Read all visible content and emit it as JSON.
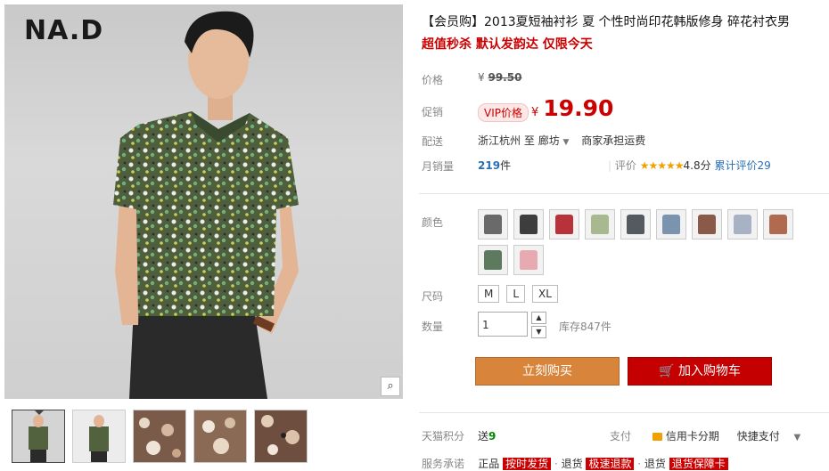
{
  "brand_logo": "NA.D",
  "product": {
    "title": "【会员购】2013夏短袖衬衫 夏 个性时尚印花韩版修身 碎花衬衣男",
    "subtitle": "超值秒杀 默认发韵达 仅限今天"
  },
  "price": {
    "label": "价格",
    "currency": "¥",
    "original": "99.50"
  },
  "promo": {
    "label": "促销",
    "badge": "VIP价格",
    "currency": "¥",
    "price": "19.90"
  },
  "shipping": {
    "label": "配送",
    "from": "浙江杭州",
    "to_word": "至",
    "destination": "廊坊",
    "note": "商家承担运费"
  },
  "sales": {
    "label": "月销量",
    "count": "219",
    "unit": "件",
    "rating_label": "评价",
    "stars": "★★★★★",
    "score": "4.8分",
    "review_link": "累计评价29"
  },
  "color": {
    "label": "颜色",
    "swatches": [
      "#6a6a6a",
      "#3d3d3d",
      "#b8323a",
      "#a9b98f",
      "#555a60",
      "#7a94b0",
      "#8a5a48",
      "#a7b2c4",
      "#b06a50",
      "#5d7a5f",
      "#e6aab0"
    ]
  },
  "size": {
    "label": "尺码",
    "options": [
      "M",
      "L",
      "XL"
    ]
  },
  "quantity": {
    "label": "数量",
    "value": "1",
    "stock": "库存847件"
  },
  "buttons": {
    "buy_now": "立刻购买",
    "add_to_cart": "加入购物车"
  },
  "points": {
    "label": "天猫积分",
    "prefix": "送",
    "value": "9",
    "pay_label": "支付",
    "credit": "信用卡分期",
    "quick_pay": "快捷支付"
  },
  "service": {
    "label": "服务承诺",
    "text1": "正品",
    "tag1": "按时发货",
    "text2": "退货",
    "tag2": "极速退款",
    "text3": "退货",
    "tag3": "退货保障卡"
  },
  "icons": {
    "zoom": "magnifier-icon",
    "cart": "cart-icon",
    "card": "credit-card-icon"
  }
}
